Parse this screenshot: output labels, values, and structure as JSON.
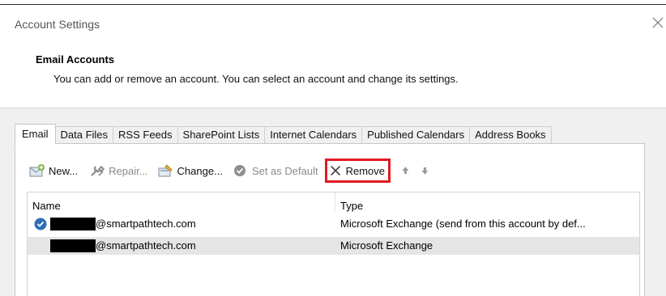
{
  "window": {
    "title": "Account Settings"
  },
  "header": {
    "title": "Email Accounts",
    "description": "You can add or remove an account. You can select an account and change its settings."
  },
  "tabs": [
    {
      "label": "Email",
      "active": true
    },
    {
      "label": "Data Files",
      "active": false
    },
    {
      "label": "RSS Feeds",
      "active": false
    },
    {
      "label": "SharePoint Lists",
      "active": false
    },
    {
      "label": "Internet Calendars",
      "active": false
    },
    {
      "label": "Published Calendars",
      "active": false
    },
    {
      "label": "Address Books",
      "active": false
    }
  ],
  "toolbar": {
    "new_label": "New...",
    "repair_label": "Repair...",
    "change_label": "Change...",
    "set_default_label": "Set as Default",
    "remove_label": "Remove",
    "icons": [
      "new-account-icon",
      "repair-icon",
      "change-icon",
      "set-default-icon",
      "remove-icon",
      "move-up-icon",
      "move-down-icon"
    ]
  },
  "account_list": {
    "columns": [
      "Name",
      "Type"
    ],
    "rows": [
      {
        "name": "@smartpathtech.com",
        "type": "Microsoft Exchange (send from this account by def...",
        "is_default": true,
        "selected": false
      },
      {
        "name": "@smartpathtech.com",
        "type": "Microsoft Exchange",
        "is_default": false,
        "selected": true
      }
    ]
  },
  "colors": {
    "highlight_box": "#e21a22",
    "selected_row": "#e5e5e5",
    "default_check": "#2d6db5"
  }
}
